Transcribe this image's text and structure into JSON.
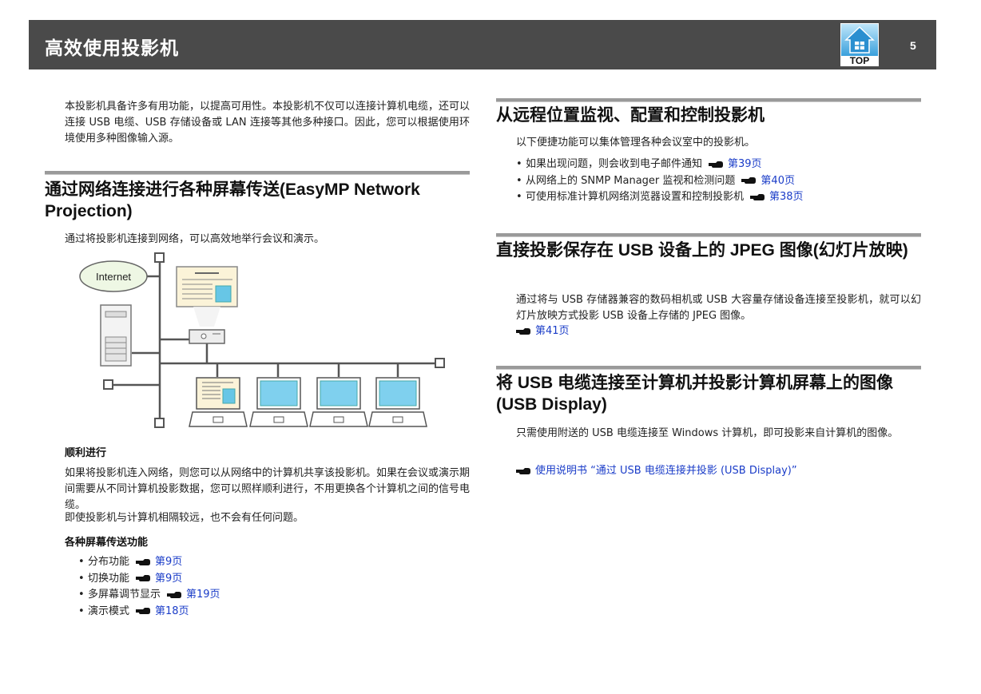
{
  "header": {
    "title": "高效使用投影机",
    "top_label": "TOP",
    "page_number": "5"
  },
  "intro": "本投影机具备许多有用功能，以提高可用性。本投影机不仅可以连接计算机电缆，还可以连接 USB 电缆、USB 存储设备或 LAN 连接等其他多种接口。因此，您可以根据使用环境使用多种图像输入源。",
  "section_network": {
    "title": "通过网络连接进行各种屏幕传送(EasyMP Network Projection)",
    "desc": "通过将投影机连接到网络，可以高效地举行会议和演示。",
    "diagram": {
      "internet_label": "Internet"
    },
    "smooth_title": "顺利进行",
    "smooth_p1": "如果将投影机连入网络，则您可以从网络中的计算机共享该投影机。如果在会议或演示期间需要从不同计算机投影数据，您可以照样顺利进行，不用更换各个计算机之间的信号电缆。",
    "smooth_p2": "即使投影机与计算机相隔较远，也不会有任何问题。",
    "features_title": "各种屏幕传送功能",
    "features": [
      {
        "label": "分布功能",
        "link": "第9页"
      },
      {
        "label": "切换功能",
        "link": "第9页"
      },
      {
        "label": "多屏幕调节显示",
        "link": "第19页"
      },
      {
        "label": "演示模式",
        "link": "第18页"
      }
    ]
  },
  "section_remote": {
    "title": "从远程位置监视、配置和控制投影机",
    "desc": "以下便捷功能可以集体管理各种会议室中的投影机。",
    "items": [
      {
        "label": "如果出现问题，则会收到电子邮件通知",
        "link": "第39页"
      },
      {
        "label": "从网络上的 SNMP Manager 监视和检测问题",
        "link": "第40页"
      },
      {
        "label": "可使用标准计算机网络浏览器设置和控制投影机",
        "link": "第38页"
      }
    ]
  },
  "section_jpeg": {
    "title": "直接投影保存在 USB 设备上的 JPEG 图像(幻灯片放映)",
    "desc": "通过将与 USB 存储器兼容的数码相机或 USB 大容量存储设备连接至投影机，就可以幻灯片放映方式投影 USB 设备上存储的 JPEG 图像。",
    "link": "第41页"
  },
  "section_usb": {
    "title": "将 USB 电缆连接至计算机并投影计算机屏幕上的图像(USB Display)",
    "desc": "只需使用附送的 USB 电缆连接至 Windows 计算机，即可投影来自计算机的图像。",
    "link": "使用说明书 “通过 USB 电缆连接并投影 (USB Display)”"
  }
}
